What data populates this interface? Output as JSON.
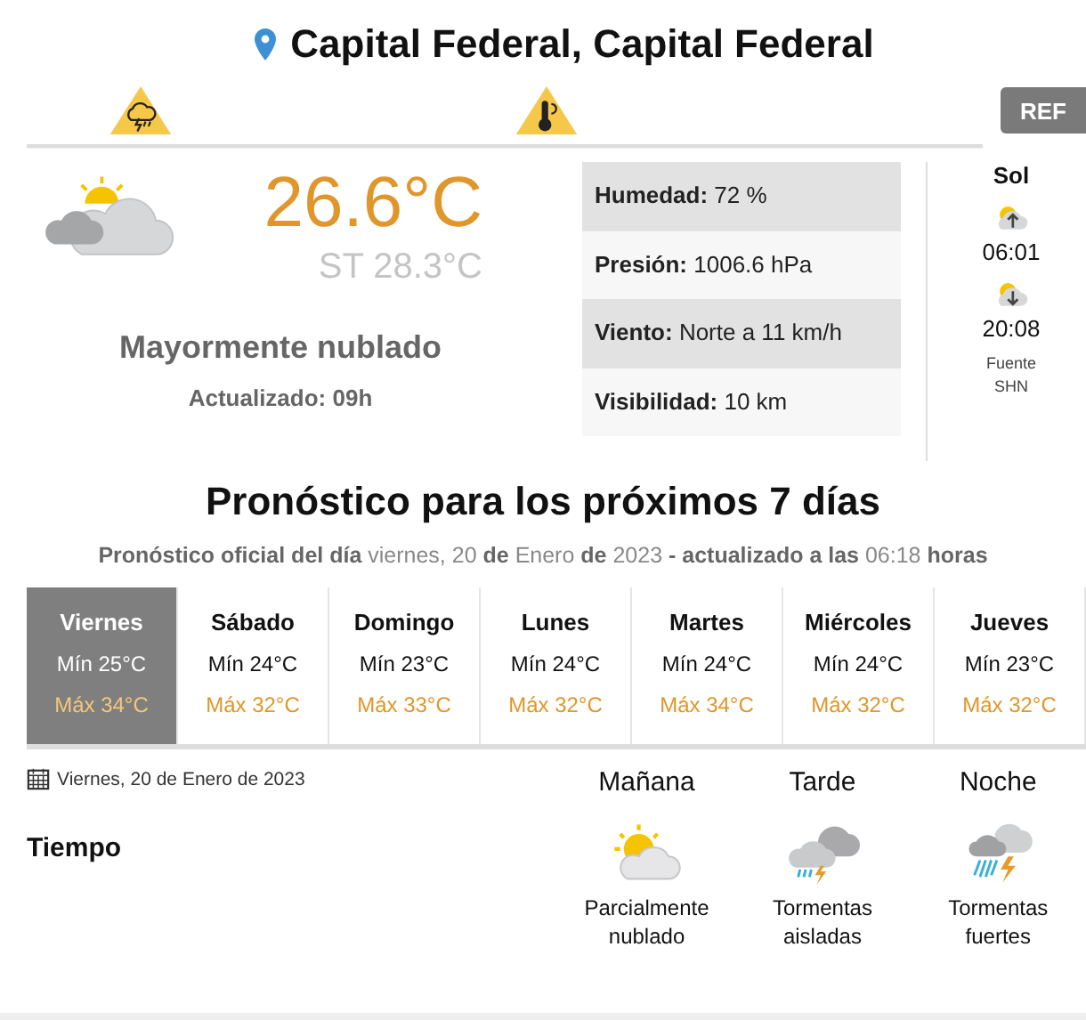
{
  "location": {
    "title": "Capital Federal, Capital Federal"
  },
  "alerts": [
    {
      "kind": "storm"
    },
    {
      "kind": "heat"
    }
  ],
  "ref_button": "REF",
  "current": {
    "temperature": "26.6°C",
    "feels_like": "ST 28.3°C",
    "description": "Mayormente nublado",
    "updated": "Actualizado: 09h"
  },
  "stats": [
    "**Humedad:** 72 %",
    "**Presión:** 1006.6 hPa",
    "**Viento:** Norte a 11 km/h",
    "**Visibilidad:** 10 km"
  ],
  "sun": {
    "title": "Sol",
    "sunrise": "06:01",
    "sunset": "20:08",
    "source": "Fuente SHN"
  },
  "forecast": {
    "title": "Pronóstico para los próximos 7 días",
    "subtitle": "**Pronóstico oficial del día** viernes, 20 **de** Enero **de** 2023 **- actualizado a las** 06:18 **horas**",
    "days": [
      {
        "name": "Viernes",
        "min": "Mín 25°C",
        "max": "Máx 34°C",
        "selected": true
      },
      {
        "name": "Sábado",
        "min": "Mín 24°C",
        "max": "Máx 32°C",
        "selected": false
      },
      {
        "name": "Domingo",
        "min": "Mín 23°C",
        "max": "Máx 33°C",
        "selected": false
      },
      {
        "name": "Lunes",
        "min": "Mín 24°C",
        "max": "Máx 32°C",
        "selected": false
      },
      {
        "name": "Martes",
        "min": "Mín 24°C",
        "max": "Máx 34°C",
        "selected": false
      },
      {
        "name": "Miércoles",
        "min": "Mín 24°C",
        "max": "Máx 32°C",
        "selected": false
      },
      {
        "name": "Jueves",
        "min": "Mín 23°C",
        "max": "Máx 32°C",
        "selected": false
      }
    ]
  },
  "detail": {
    "date": "Viernes, 20 de Enero de 2023",
    "row_label": "Tiempo",
    "periods": [
      {
        "name": "Mañana",
        "kind": "partly-cloudy",
        "description": "Parcialmente nublado"
      },
      {
        "name": "Tarde",
        "kind": "isolated-storms",
        "description": "Tormentas aisladas"
      },
      {
        "name": "Noche",
        "kind": "strong-storms",
        "description": "Tormentas fuertes"
      }
    ]
  }
}
